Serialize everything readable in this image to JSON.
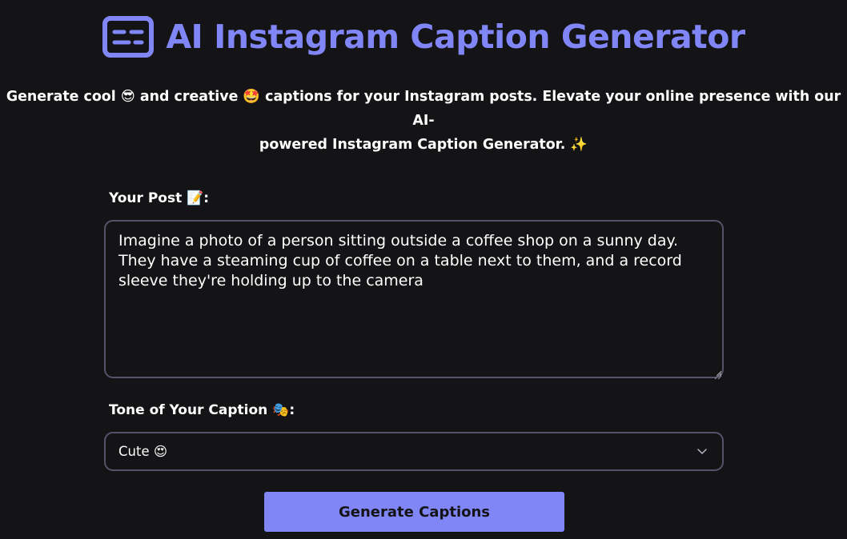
{
  "header": {
    "logo_icon": "caption-icon",
    "title": "AI Instagram Caption Generator"
  },
  "subtitle": {
    "line1": "Generate cool 😎 and creative 🤩 captions for your Instagram posts. Elevate your online presence with our AI-",
    "line2": "powered Instagram Caption Generator. ✨"
  },
  "form": {
    "post_label": "Your Post 📝:",
    "post_value": "Imagine a photo of a person sitting outside a coffee shop on a sunny day. They have a steaming cup of coffee on a table next to them, and a record sleeve they're holding up to the camera",
    "tone_label": "Tone of Your Caption 🎭:",
    "tone_value": "Cute 😍",
    "generate_label": "Generate Captions"
  },
  "colors": {
    "accent": "#8186f7",
    "background": "#141416",
    "border": "#55526a"
  }
}
